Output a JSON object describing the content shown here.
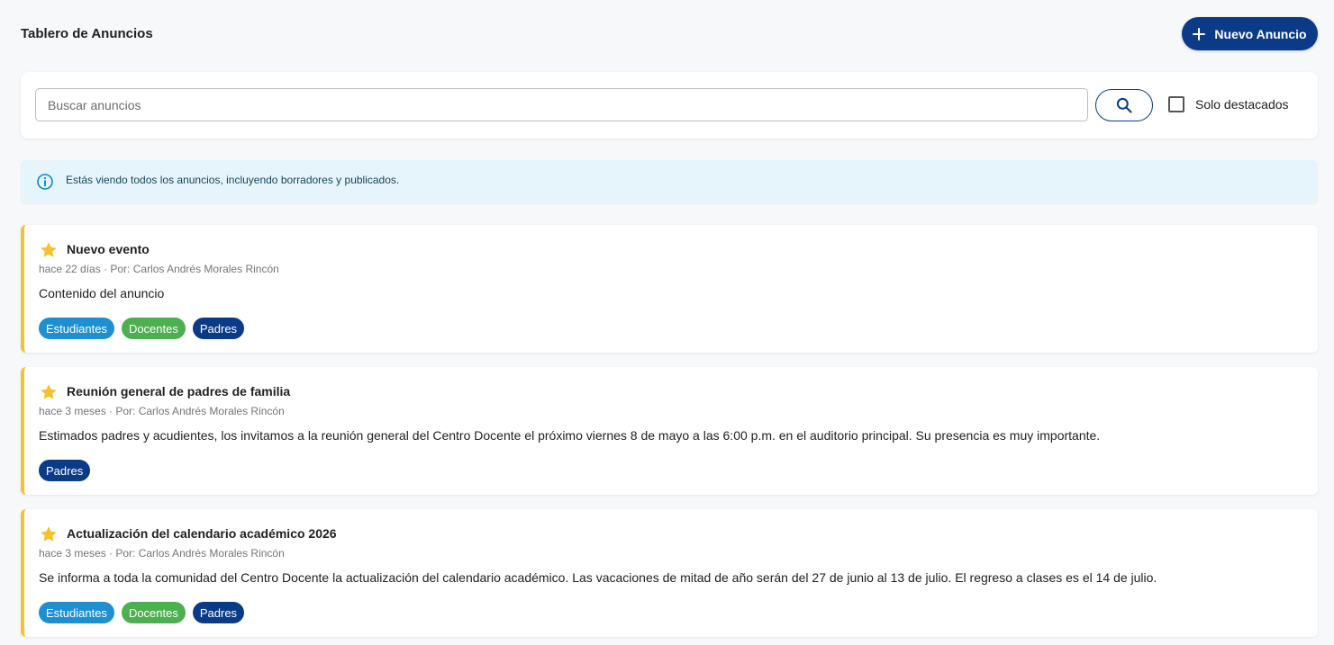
{
  "header": {
    "title": "Tablero de Anuncios",
    "new_button_label": "Nuevo Anuncio"
  },
  "search": {
    "placeholder": "Buscar anuncios",
    "value": "",
    "featured_only_label": "Solo destacados",
    "featured_only_checked": false
  },
  "info_alert": {
    "text": "Estás viendo todos los anuncios, incluyendo borradores y publicados."
  },
  "colors": {
    "primary": "#0b3b87",
    "featured_accent": "#f6c12a",
    "tag_estudiantes": "#1e90d2",
    "tag_docentes": "#4caf50",
    "tag_padres": "#0b3b87",
    "info_bg": "#e6f5fb"
  },
  "announcements": [
    {
      "featured": true,
      "title": "Nuevo evento",
      "meta": "hace 22 días · Por: Carlos Andrés Morales Rincón",
      "body": "Contenido del anuncio",
      "tags": [
        "Estudiantes",
        "Docentes",
        "Padres"
      ]
    },
    {
      "featured": true,
      "title": "Reunión general de padres de familia",
      "meta": "hace 3 meses · Por: Carlos Andrés Morales Rincón",
      "body": "Estimados padres y acudientes, los invitamos a la reunión general del Centro Docente el próximo viernes 8 de mayo a las 6:00 p.m. en el auditorio principal. Su presencia es muy importante.",
      "tags": [
        "Padres"
      ]
    },
    {
      "featured": true,
      "title": "Actualización del calendario académico 2026",
      "meta": "hace 3 meses · Por: Carlos Andrés Morales Rincón",
      "body": "Se informa a toda la comunidad del Centro Docente la actualización del calendario académico. Las vacaciones de mitad de año serán del 27 de junio al 13 de julio. El regreso a clases es el 14 de julio.",
      "tags": [
        "Estudiantes",
        "Docentes",
        "Padres"
      ]
    }
  ]
}
